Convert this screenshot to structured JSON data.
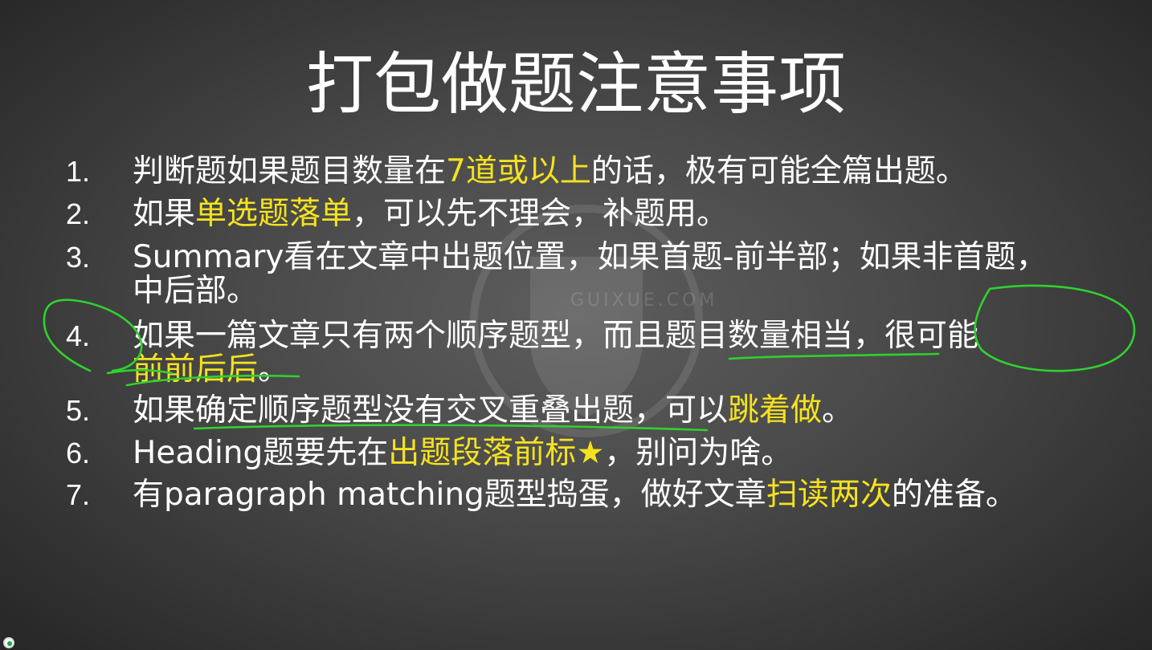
{
  "slide": {
    "title": "打包做题注意事项",
    "watermark": "GUIXUE.COM",
    "items": [
      {
        "num": "1.",
        "parts": [
          "判断题如果题目数量在",
          "7道或以上",
          "的话，极有可能全篇出题。"
        ]
      },
      {
        "num": "2.",
        "parts": [
          "如果",
          "单选题落单",
          "，可以先不理会，补题用。"
        ]
      },
      {
        "num": "3.",
        "line1": "Summary看在文章中出题位置，如果首题-前半部；如果非首题，",
        "line2": "中后部。"
      },
      {
        "num": "4.",
        "line1": "如果一篇文章只有两个顺序题型，而且题目数量相当，很可能",
        "line2_hl": "前前后后",
        "line2_end": "。"
      },
      {
        "num": "5.",
        "parts": [
          "如果确定顺序题型没有交叉重叠出题，可以",
          "跳着做",
          "。"
        ]
      },
      {
        "num": "6.",
        "parts": [
          "Heading题要先在",
          "出题段落前标",
          "★",
          "，别问为啥。"
        ]
      },
      {
        "num": "7.",
        "parts": [
          "有paragraph matching题型捣蛋，做好文章",
          "扫读两次",
          "的准备。"
        ]
      }
    ]
  },
  "colors": {
    "background": "#4a4a4a",
    "text": "#ffffff",
    "highlight": "#f5e21f",
    "annotation": "#2fd12f"
  },
  "icons": [
    "star-icon",
    "status-dot-icon"
  ]
}
